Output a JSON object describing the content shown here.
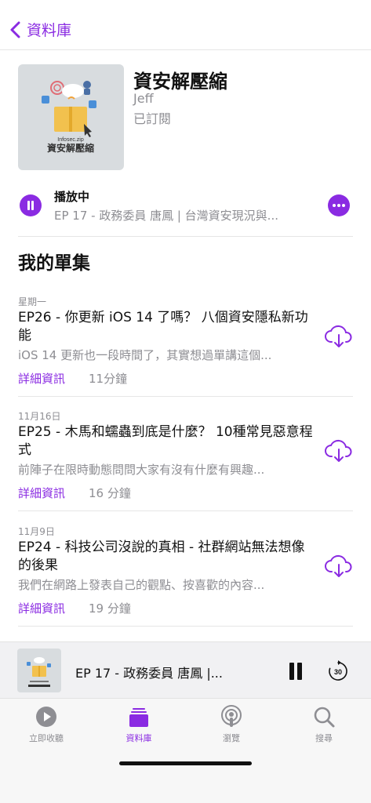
{
  "nav": {
    "back_label": "資料庫"
  },
  "show": {
    "title": "資安解壓縮",
    "author": "Jeff",
    "subscribed": "已訂閱",
    "art_small_text": "Infosec.zip",
    "art_big_text": "資安解壓縮"
  },
  "now_playing": {
    "label": "播放中",
    "episode": "EP 17 - 政務委員 唐鳳 | 台灣資安現況與..."
  },
  "section_title": "我的單集",
  "episodes": [
    {
      "date": "星期一",
      "title": "EP26 - 你更新 iOS 14 了嗎？ 八個資安隱私新功能",
      "desc": "iOS 14 更新也一段時間了，其實想過單講這個...",
      "details": "詳細資訊",
      "duration": "11分鐘"
    },
    {
      "date": "11月16日",
      "title": "EP25 - 木馬和蠕蟲到底是什麼？ 10種常見惡意程式",
      "desc": "前陣子在限時動態問問大家有沒有什麼有興趣...",
      "details": "詳細資訊",
      "duration": "16 分鐘"
    },
    {
      "date": "11月9日",
      "title": "EP24 - 科技公司沒說的真相 - 社群網站無法想像的後果",
      "desc": "我們在網路上發表自己的觀點、按喜歡的內容...",
      "details": "詳細資訊",
      "duration": "19 分鐘"
    }
  ],
  "mini_player": {
    "title": "EP 17 - 政務委員 唐鳳 |...",
    "skip_seconds": "30"
  },
  "tabs": [
    {
      "label": "立即收聽",
      "icon": "play-circle-icon"
    },
    {
      "label": "資料庫",
      "icon": "library-icon"
    },
    {
      "label": "瀏覽",
      "icon": "podcast-icon"
    },
    {
      "label": "搜尋",
      "icon": "search-icon"
    }
  ],
  "colors": {
    "accent": "#8a2be2",
    "secondary_text": "#8e8e93"
  }
}
